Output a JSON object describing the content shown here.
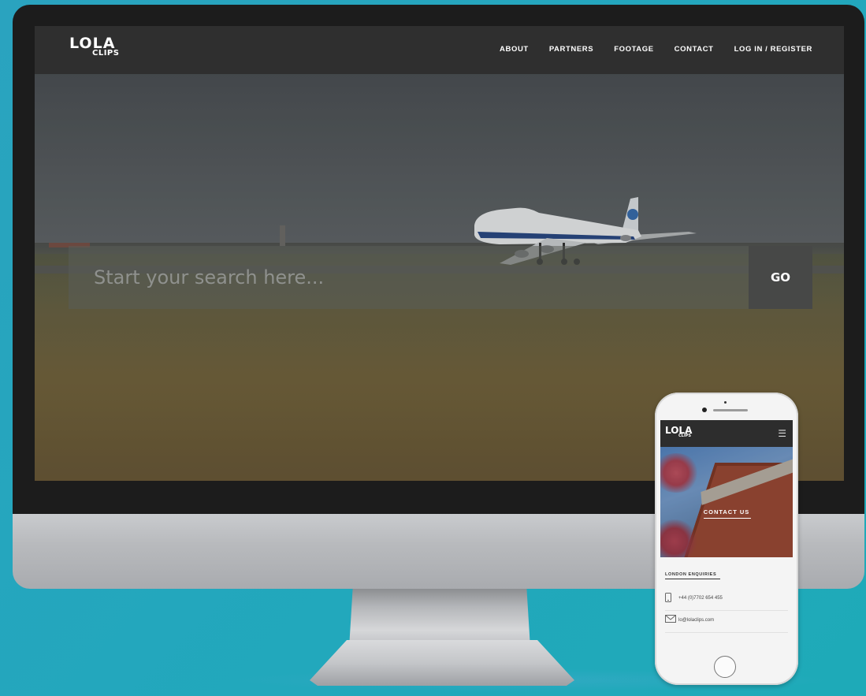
{
  "desktop_site": {
    "logo": {
      "line1": "LOLA",
      "line2": "CLIPS"
    },
    "nav": [
      {
        "label": "ABOUT"
      },
      {
        "label": "PARTNERS"
      },
      {
        "label": "FOOTAGE"
      },
      {
        "label": "CONTACT"
      },
      {
        "label": "LOG IN / REGISTER"
      }
    ],
    "search": {
      "placeholder": "Start your search here...",
      "button_label": "GO"
    }
  },
  "mobile_site": {
    "logo": {
      "line1": "LOLA",
      "line2": "CLIPS"
    },
    "menu_icon": "hamburger-icon",
    "hero_title": "CONTACT US",
    "section_title": "LONDON ENQUIRIES",
    "contacts": [
      {
        "icon": "phone-icon",
        "text": "+44 (0)7702 654 455"
      },
      {
        "icon": "envelope-icon",
        "text": "lo@lolaclips.com"
      }
    ]
  },
  "colors": {
    "background": "#23a7bd",
    "nav_bar": "#2f2f2f",
    "go_button": "#474847"
  }
}
